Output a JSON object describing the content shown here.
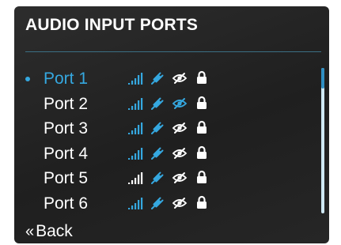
{
  "header": {
    "title": "AUDIO INPUT PORTS"
  },
  "colors": {
    "accent": "#35a8e0",
    "text": "#ffffff",
    "background": "#262626",
    "scrollbar_thumb": "#2f8fc2",
    "scrollbar_track": "#cfe9f5"
  },
  "ports": [
    {
      "label": "Port 1",
      "selected": true,
      "signal_color": "#35a8e0",
      "plug_color": "#35a8e0",
      "eye_color": "#ffffff",
      "lock_color": "#ffffff"
    },
    {
      "label": "Port 2",
      "selected": false,
      "signal_color": "#35a8e0",
      "plug_color": "#35a8e0",
      "eye_color": "#35a8e0",
      "lock_color": "#ffffff"
    },
    {
      "label": "Port 3",
      "selected": false,
      "signal_color": "#35a8e0",
      "plug_color": "#35a8e0",
      "eye_color": "#ffffff",
      "lock_color": "#ffffff"
    },
    {
      "label": "Port 4",
      "selected": false,
      "signal_color": "#35a8e0",
      "plug_color": "#35a8e0",
      "eye_color": "#ffffff",
      "lock_color": "#ffffff"
    },
    {
      "label": "Port 5",
      "selected": false,
      "signal_color": "#ffffff",
      "plug_color": "#35a8e0",
      "eye_color": "#ffffff",
      "lock_color": "#ffffff"
    },
    {
      "label": "Port 6",
      "selected": false,
      "signal_color": "#35a8e0",
      "plug_color": "#35a8e0",
      "eye_color": "#ffffff",
      "lock_color": "#ffffff"
    }
  ],
  "icons": [
    "signal-bars-icon",
    "plug-icon",
    "eye-hidden-icon",
    "lock-icon"
  ],
  "footer": {
    "back_label": "Back",
    "back_icon": "double-chevron-left-icon"
  }
}
